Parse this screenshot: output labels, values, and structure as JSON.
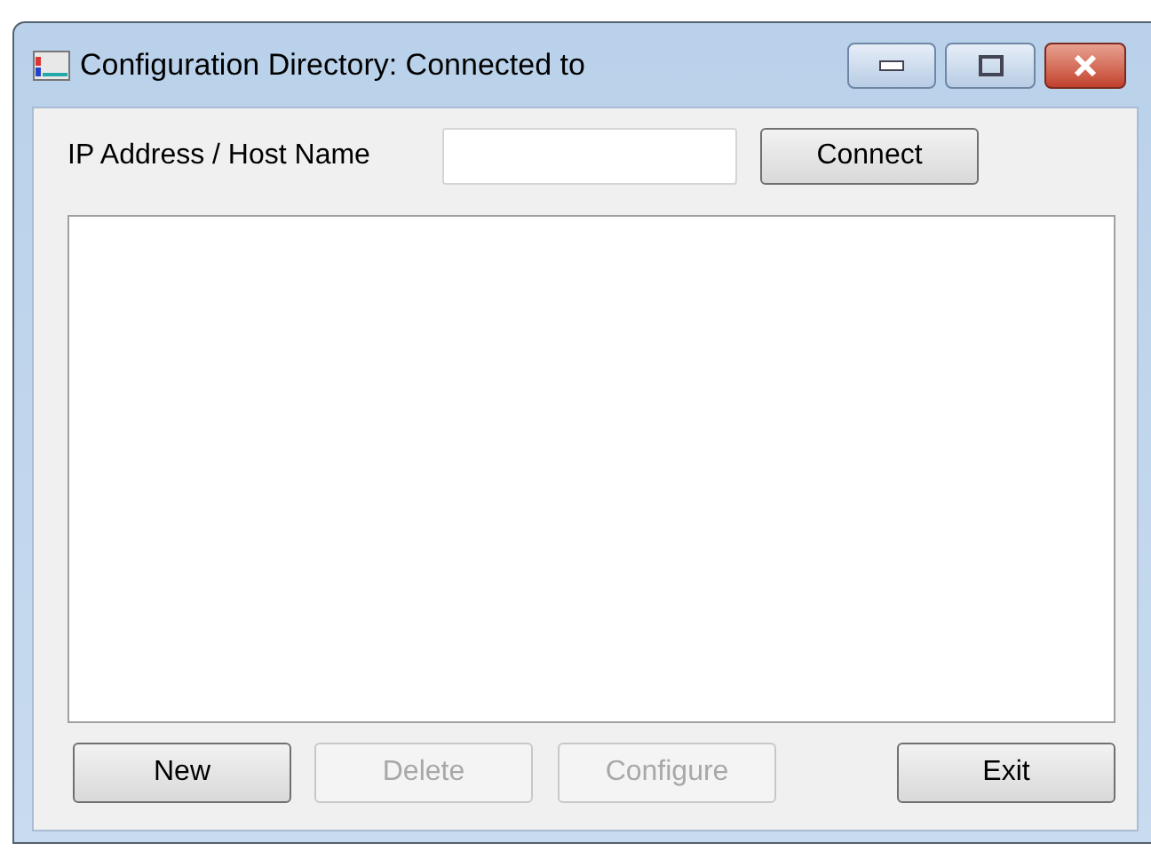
{
  "window": {
    "title": "Configuration Directory: Connected to"
  },
  "address": {
    "label": "IP Address / Host Name",
    "button": "Connect"
  },
  "buttons": [
    {
      "label": "New",
      "disabled": false
    },
    {
      "label": "Delete",
      "disabled": true
    },
    {
      "label": "Configure",
      "disabled": true
    },
    {
      "label": "Exit",
      "disabled": false
    }
  ]
}
